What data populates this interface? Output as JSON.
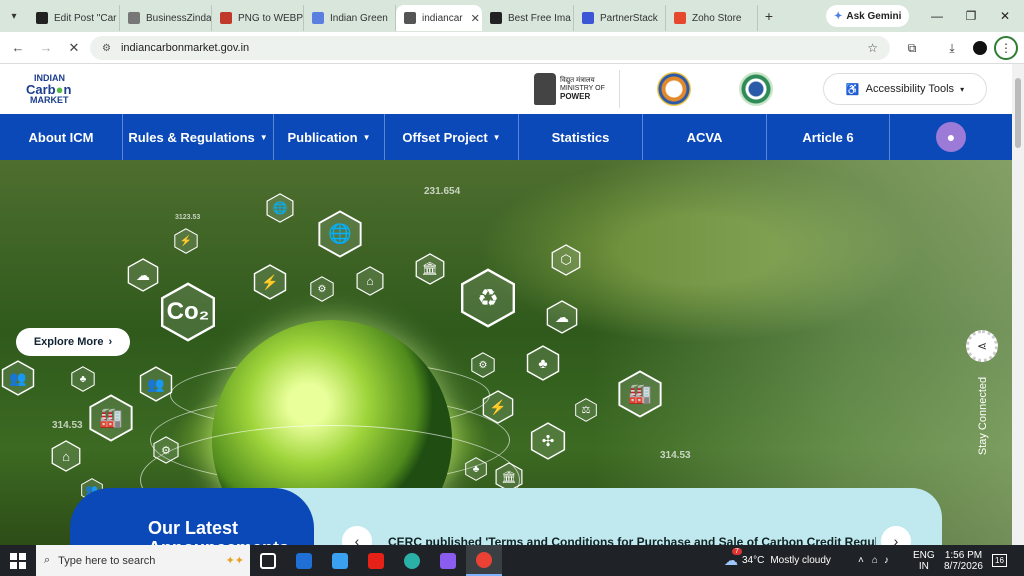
{
  "browser": {
    "tabs": [
      {
        "label": "Edit Post \"Car",
        "color": "#222",
        "active": false
      },
      {
        "label": "BusinessZinda",
        "color": "#777",
        "active": false
      },
      {
        "label": "PNG to WEBP",
        "color": "#c0392b",
        "active": false
      },
      {
        "label": "Indian Green",
        "color": "#5b7fe0",
        "active": false
      },
      {
        "label": "indiancar",
        "color": "#555",
        "active": true
      },
      {
        "label": "Best Free Ima",
        "color": "#222",
        "active": false
      },
      {
        "label": "PartnerStack",
        "color": "#3c56d6",
        "active": false
      },
      {
        "label": "Zoho Store",
        "color": "#e5482d",
        "active": false
      }
    ],
    "gemini_label": "Ask Gemini",
    "url": "indiancarbonmarket.gov.in"
  },
  "header": {
    "logo_line1": "INDIAN",
    "logo_line2a": "Carb",
    "logo_line2b": "n",
    "logo_line3": "MARKET",
    "ministry_hindi": "विद्युत मंत्रालय",
    "ministry_line1": "MINISTRY OF",
    "ministry_line2": "POWER",
    "accessibility_label": "Accessibility Tools"
  },
  "nav": {
    "items": [
      {
        "label": "About ICM",
        "caret": false,
        "width": 123
      },
      {
        "label": "Rules & Regulations",
        "caret": true,
        "width": 151
      },
      {
        "label": "Publication",
        "caret": true,
        "width": 111
      },
      {
        "label": "Offset Project",
        "caret": true,
        "width": 134
      },
      {
        "label": "Statistics",
        "caret": false,
        "width": 124
      },
      {
        "label": "ACVA",
        "caret": false,
        "width": 124
      },
      {
        "label": "Article 6",
        "caret": false,
        "width": 123
      }
    ]
  },
  "hero": {
    "explore_label": "Explore More",
    "numbers": [
      "231.654",
      "314.53",
      "314.53",
      "3123.53"
    ],
    "co2_label": "Co₂",
    "stay_connected": "Stay Connected"
  },
  "announcements": {
    "heading_line1": "Our Latest",
    "heading_line2": "Announcements",
    "text": "CERC published 'Terms and Conditions for Purchase and Sale of Carbon Credit Regula"
  },
  "taskbar": {
    "search_placeholder": "Type here to search",
    "weather_temp": "34°C",
    "weather_desc": "Mostly cloudy",
    "weather_badge": "7",
    "lang_line1": "ENG",
    "lang_line2": "IN",
    "time": "1:56 PM",
    "date": "8/7/2026",
    "notif_count": "16"
  }
}
